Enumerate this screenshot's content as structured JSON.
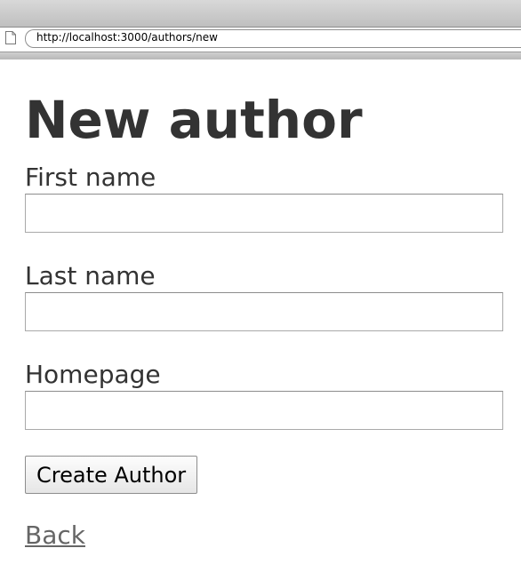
{
  "browser": {
    "url": "http://localhost:3000/authors/new"
  },
  "page": {
    "title": "New author",
    "fields": [
      {
        "label": "First name",
        "value": ""
      },
      {
        "label": "Last name",
        "value": ""
      },
      {
        "label": "Homepage",
        "value": ""
      }
    ],
    "submit_label": "Create Author",
    "back_label": "Back"
  }
}
